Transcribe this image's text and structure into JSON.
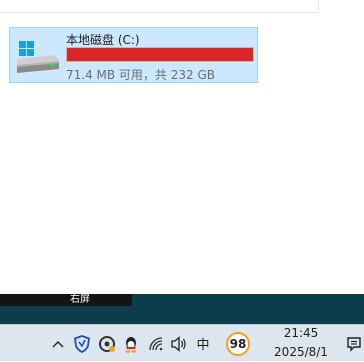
{
  "drive": {
    "name": "本地磁盘 (C:)",
    "free_text": "71.4 MB 可用，共 232 GB",
    "used_fraction": 0.9997,
    "bar_color": "#da2626",
    "icon": "windows-drive-icon"
  },
  "tooltip": {
    "text": "右屏"
  },
  "taskbar": {
    "tray_icons": [
      "chevron-up-icon",
      "shield-icon",
      "qq-browser-icon",
      "qq-icon",
      "wifi-icon",
      "volume-icon"
    ],
    "ime_label": "中",
    "badge_value": "98",
    "time": "21:45",
    "date": "2025/8/1",
    "notification_icon": "notification-icon"
  },
  "colors": {
    "selection_bg": "#cce8ff",
    "taskbar_bg": "#dbe6ee",
    "wallpaper": "#0c3d4c"
  }
}
